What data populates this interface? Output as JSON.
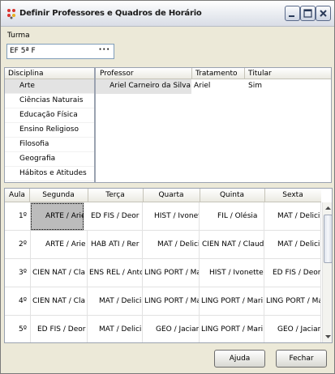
{
  "window": {
    "title": "Definir Professores e Quadros de Horário"
  },
  "turma": {
    "label": "Turma",
    "value": "EF 5ª F",
    "browse_label": "···"
  },
  "disciplinas": {
    "header": "Disciplina",
    "items": [
      {
        "label": "Arte",
        "selected": true
      },
      {
        "label": "Ciências Naturais"
      },
      {
        "label": "Educação Física"
      },
      {
        "label": "Ensino Religioso"
      },
      {
        "label": "Filosofia"
      },
      {
        "label": "Geografia"
      },
      {
        "label": "Hábitos e Atitudes"
      }
    ]
  },
  "professores": {
    "headers": [
      "Professor",
      "Tratamento",
      "Titular"
    ],
    "rows": [
      {
        "professor": "Ariel Carneiro da Silva",
        "tratamento": "Ariel",
        "titular": "Sim"
      }
    ]
  },
  "horario": {
    "headers": [
      "Aula",
      "Segunda",
      "Terça",
      "Quarta",
      "Quinta",
      "Sexta"
    ],
    "rows": [
      {
        "aula": "1º",
        "cells": [
          "ARTE / Arie",
          "ED FIS / Deor",
          "HIST / Ivonet",
          "FIL / Olésia",
          "MAT / Delici"
        ]
      },
      {
        "aula": "2º",
        "cells": [
          "ARTE / Arie",
          "HAB ATI / Rer",
          "MAT / Delicie",
          "CIEN NAT / Claud",
          "MAT / Delici"
        ]
      },
      {
        "aula": "3º",
        "cells": [
          "CIEN NAT / Cla",
          "ENS REL / Antc",
          "LING PORT / Ma",
          "HIST / Ivonette",
          "ED FIS / Deor"
        ]
      },
      {
        "aula": "4º",
        "cells": [
          "CIEN NAT / Cla",
          "MAT / Delici",
          "LING PORT / Ma",
          "LING PORT / Mari",
          "LING PORT / Ma"
        ]
      },
      {
        "aula": "5º",
        "cells": [
          "ED FIS / Deor",
          "MAT / Delici",
          "GEO / Jaciar",
          "LING PORT / Mari",
          "GEO / Jaciar"
        ]
      }
    ]
  },
  "buttons": {
    "help": "Ajuda",
    "close": "Fechar"
  },
  "colors": {
    "selection_gray": "#bcbcbc",
    "list_selected": "#e3e3e3"
  },
  "icons": {
    "app": "dots-app-icon",
    "minimize": "minimize-icon",
    "maximize": "maximize-icon",
    "close": "close-icon"
  }
}
